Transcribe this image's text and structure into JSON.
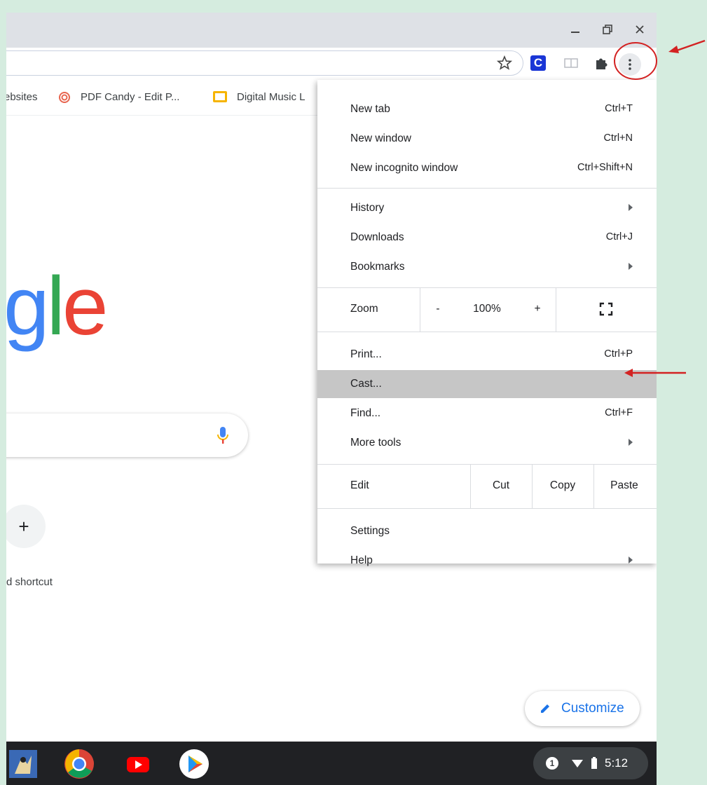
{
  "window": {
    "minimize_icon": "minimize-icon",
    "restore_icon": "restore-icon",
    "close_icon": "close-icon"
  },
  "toolbar": {
    "extension_label": "C"
  },
  "bookmarks": [
    {
      "label": "ebsites"
    },
    {
      "label": "PDF Candy - Edit P..."
    },
    {
      "label": "Digital Music L"
    }
  ],
  "page": {
    "logo_text": "gle",
    "add_shortcut_plus": "+",
    "add_shortcut_label": "d shortcut",
    "customize_label": "Customize"
  },
  "menu": {
    "new_tab": {
      "label": "New tab",
      "shortcut": "Ctrl+T"
    },
    "new_window": {
      "label": "New window",
      "shortcut": "Ctrl+N"
    },
    "new_incognito": {
      "label": "New incognito window",
      "shortcut": "Ctrl+Shift+N"
    },
    "history": {
      "label": "History"
    },
    "downloads": {
      "label": "Downloads",
      "shortcut": "Ctrl+J"
    },
    "bookmarks": {
      "label": "Bookmarks"
    },
    "zoom": {
      "label": "Zoom",
      "minus": "-",
      "value": "100%",
      "plus": "+"
    },
    "print": {
      "label": "Print...",
      "shortcut": "Ctrl+P"
    },
    "cast": {
      "label": "Cast..."
    },
    "find": {
      "label": "Find...",
      "shortcut": "Ctrl+F"
    },
    "more_tools": {
      "label": "More tools"
    },
    "edit": {
      "label": "Edit",
      "cut": "Cut",
      "copy": "Copy",
      "paste": "Paste"
    },
    "settings": {
      "label": "Settings"
    },
    "help": {
      "label": "Help"
    }
  },
  "taskbar": {
    "notification_count": "1",
    "time": "5:12"
  },
  "colors": {
    "highlight": "#c6c6c6",
    "annotation": "#d32222",
    "accent": "#1a73e8"
  }
}
